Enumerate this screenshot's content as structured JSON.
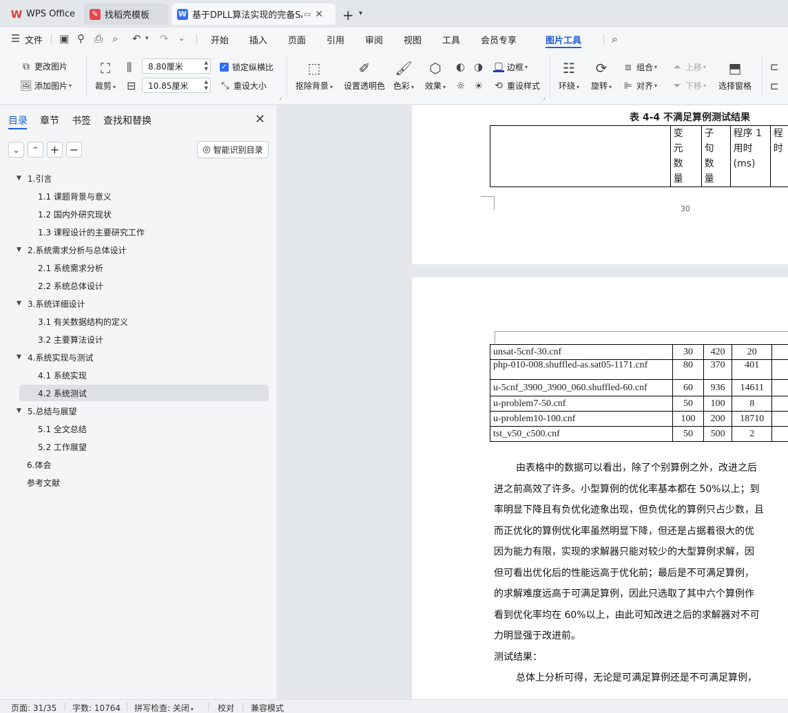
{
  "titlebar": {
    "tabs": [
      {
        "label": "WPS Office"
      },
      {
        "label": "找稻壳模板"
      },
      {
        "label": "基于DPLL算法实现的完备SAT"
      }
    ],
    "new_tab": "+"
  },
  "menubar": {
    "file": "文件",
    "items": [
      "开始",
      "插入",
      "页面",
      "引用",
      "审阅",
      "视图",
      "工具",
      "会员专享",
      "图片工具"
    ],
    "active": "图片工具"
  },
  "ribbon": {
    "change_image": "更改图片",
    "add_image": "添加图片",
    "crop": "裁剪",
    "width_value": "8.80厘米",
    "height_value": "10.85厘米",
    "lock_ratio": "锁定纵横比",
    "reset_size": "重设大小",
    "remove_bg": "抠除背景",
    "set_transparent": "设置透明色",
    "color": "色彩",
    "effect": "效果",
    "border": "边框",
    "reset_style": "重设样式",
    "wrap": "环绕",
    "rotate": "旋转",
    "group": "组合",
    "align": "对齐",
    "move_up": "上移",
    "move_down": "下移",
    "select_pane": "选择窗格"
  },
  "sidebar": {
    "tabs": [
      "目录",
      "章节",
      "书签",
      "查找和替换"
    ],
    "smart_toc": "智能识别目录",
    "toc": [
      {
        "label": "1.引言",
        "level": 1
      },
      {
        "label": "1.1 课题背景与意义",
        "level": 2
      },
      {
        "label": "1.2 国内外研究现状",
        "level": 2
      },
      {
        "label": "1.3 课程设计的主要研究工作",
        "level": 2
      },
      {
        "label": "2.系统需求分析与总体设计",
        "level": 1
      },
      {
        "label": "2.1 系统需求分析",
        "level": 2
      },
      {
        "label": "2.2 系统总体设计",
        "level": 2
      },
      {
        "label": "3.系统详细设计",
        "level": 1
      },
      {
        "label": "3.1 有关数据结构的定义",
        "level": 2
      },
      {
        "label": "3.2 主要算法设计",
        "level": 2
      },
      {
        "label": "4.系统实现与测试",
        "level": 1
      },
      {
        "label": "4.1 系统实现",
        "level": 2
      },
      {
        "label": "4.2 系统测试",
        "level": 2
      },
      {
        "label": "5.总结与展望",
        "level": 1
      },
      {
        "label": "5.1 全文总结",
        "level": 2
      },
      {
        "label": "5.2 工作展望",
        "level": 2
      },
      {
        "label": "6.体会",
        "level": 0
      },
      {
        "label": "参考文献",
        "level": 0
      }
    ]
  },
  "document": {
    "table_caption": "表 4-4  不满足算例测试结果",
    "header": {
      "col1": [
        "变",
        "元",
        "数",
        "量"
      ],
      "col2": [
        "子",
        "句",
        "数",
        "量"
      ],
      "col3": [
        "程序 1",
        "用时",
        "(ms)"
      ],
      "col4": [
        "程",
        "时"
      ]
    },
    "page_number": "30",
    "rows": [
      {
        "name": "unsat-5cnf-30.cnf",
        "vars": "30",
        "clauses": "420",
        "time": "20"
      },
      {
        "name": "php-010-008.shuffled-as.sat05-1171.cnf",
        "vars": "80",
        "clauses": "370",
        "time": "401"
      },
      {
        "name": "u-5cnf_3900_3900_060.shuffled-60.cnf",
        "vars": "60",
        "clauses": "936",
        "time": "14611"
      },
      {
        "name": "u-problem7-50.cnf",
        "vars": "50",
        "clauses": "100",
        "time": "8"
      },
      {
        "name": "u-problem10-100.cnf",
        "vars": "100",
        "clauses": "200",
        "time": "18710"
      },
      {
        "name": "tst_v50_c500.cnf",
        "vars": "50",
        "clauses": "500",
        "time": "2"
      }
    ],
    "paragraph": [
      "由表格中的数据可以看出，除了个别算例之外，改进之后",
      "进之前高效了许多。小型算例的优化率基本都在 50%以上；到",
      "率明显下降且有负优化迹象出现，但负优化的算例只占少数，且",
      "而正优化的算例优化率虽然明显下降，但还是占据着很大的优",
      "因为能力有限，实现的求解器只能对较少的大型算例求解，因",
      "但可看出优化后的性能远高于优化前；最后是不可满足算例，",
      "的求解难度远高于可满足算例，因此只选取了其中六个算例作",
      "看到优化率均在 60%以上，由此可知改进之后的求解器对不可",
      "力明显强于改进前。"
    ],
    "result_title": "测试结果：",
    "last_line": "总体上分析可得，无论是可满足算例还是不可满足算例，"
  },
  "statusbar": {
    "page": "页面: 31/35",
    "words": "字数: 10764",
    "spell": "拼写检查: 关闭",
    "proof": "校对",
    "compat": "兼容模式"
  }
}
